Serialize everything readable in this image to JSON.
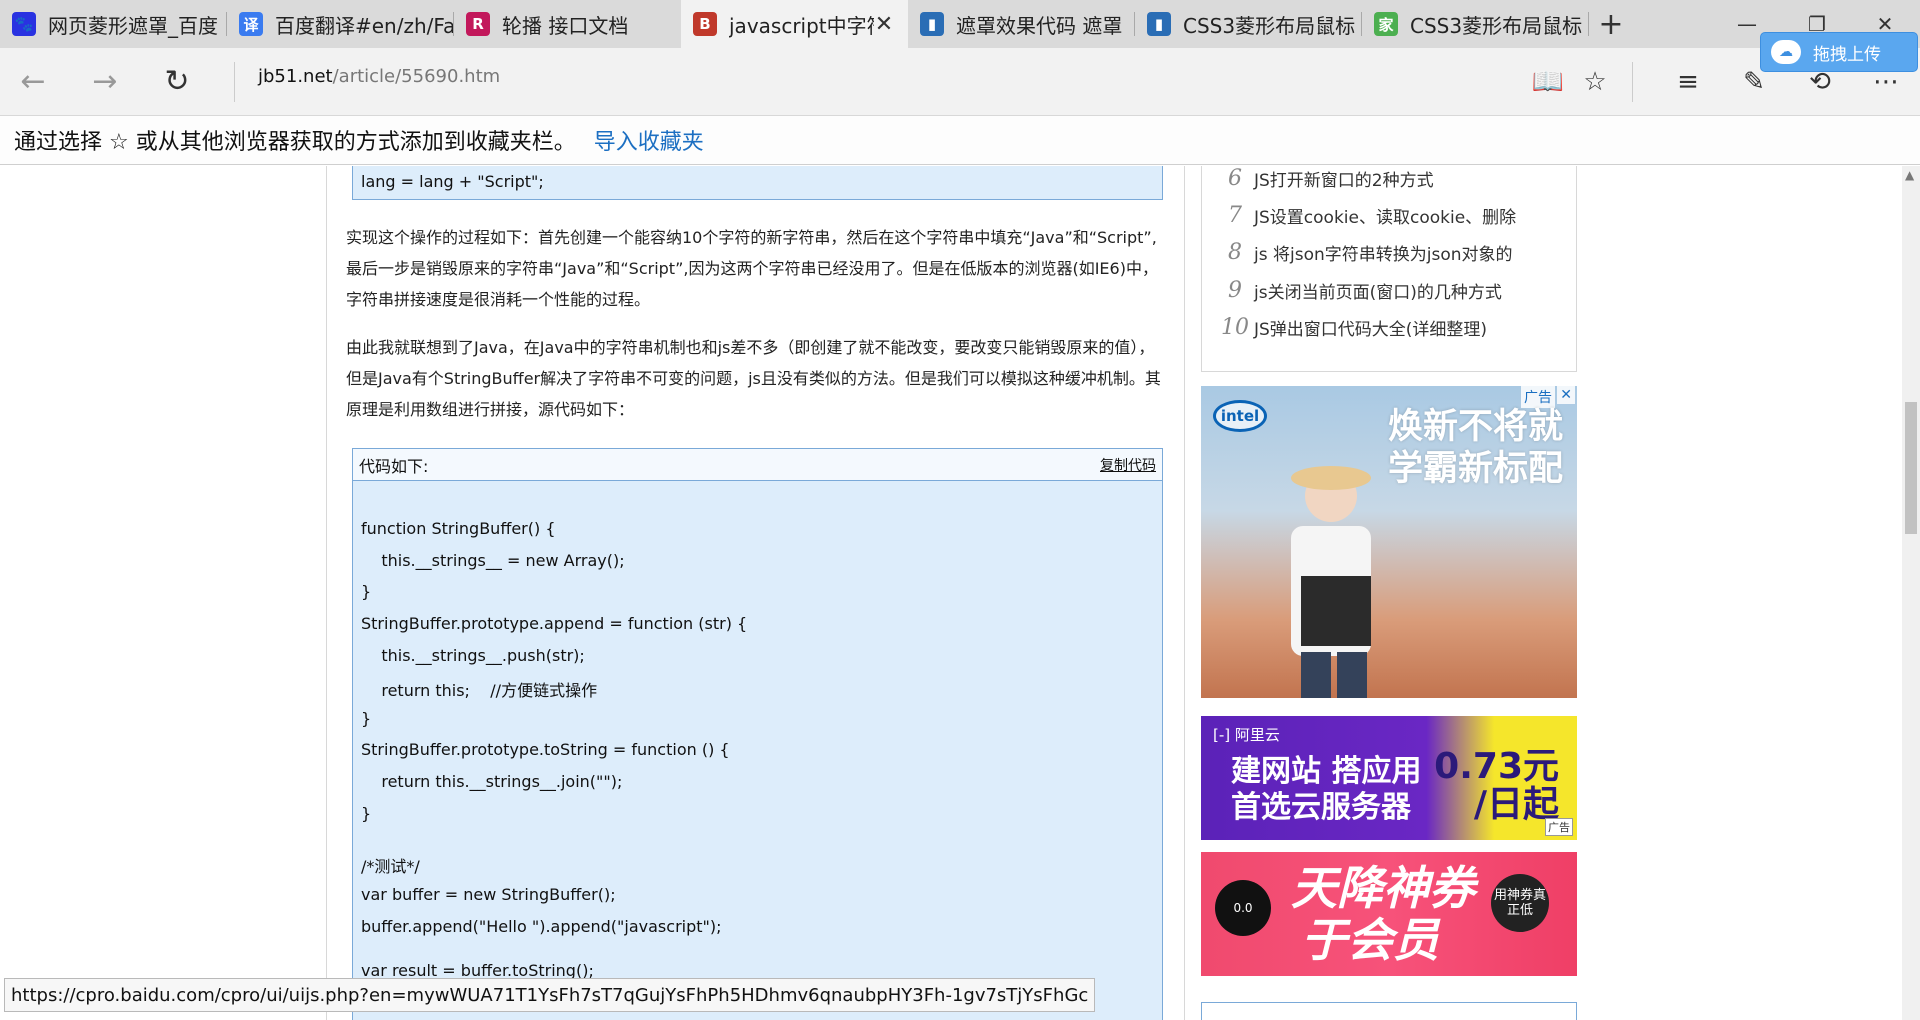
{
  "tabs": [
    {
      "label": "网页菱形遮罩_百度",
      "icon": "baidu-paw-icon",
      "icon_glyph": "🐾",
      "icon_color": "#2932e1"
    },
    {
      "label": "百度翻译#en/zh/Fa",
      "icon": "translate-icon",
      "icon_glyph": "译",
      "icon_color": "#3a7bf0"
    },
    {
      "label": "轮播 接口文档",
      "icon": "r-logo-icon",
      "icon_glyph": "R",
      "icon_color": "#c2185b"
    },
    {
      "label": "javascript中字符",
      "icon": "jb51-logo-icon",
      "icon_glyph": "B",
      "icon_color": "#c0392b"
    },
    {
      "label": "遮罩效果代码 遮罩",
      "icon": "site-logo-icon",
      "icon_glyph": "▮",
      "icon_color": "#2a6db5"
    },
    {
      "label": "CSS3菱形布局鼠标",
      "icon": "site-logo-icon",
      "icon_glyph": "▮",
      "icon_color": "#2a6db5"
    },
    {
      "label": "CSS3菱形布局鼠标",
      "icon": "home-logo-icon",
      "icon_glyph": "家",
      "icon_color": "#4caf50"
    }
  ],
  "address": {
    "host": "jb51.net",
    "path": "/article/55690.htm"
  },
  "upload_label": "拖拽上传",
  "favbar": {
    "text": "通过选择 ☆ 或从其他浏览器获取的方式添加到收藏夹栏。",
    "link": "导入收藏夹"
  },
  "article": {
    "top_code_line": "lang = lang + \"Script\";",
    "para1": " 实现这个操作的过程如下：首先创建一个能容纳10个字符的新字符串，然后在这个字符串中填充“Java”和“Script”,最后一步是销毁原来的字符串“Java”和“Script”,因为这两个字符串已经没用了。但是在低版本的浏览器(如IE6)中，字符串拼接速度是很消耗一个性能的过程。",
    "para2": "由此我就联想到了Java，在Java中的字符串机制也和js差不多（即创建了就不能改变，要改变只能销毁原来的值），但是Java有个StringBuffer解决了字符串不可变的问题，js且没有类似的方法。但是我们可以模拟这种缓冲机制。其原理是利用数组进行拼接，源代码如下：",
    "code_header": "代码如下:",
    "copy_label": "复制代码",
    "code_lines": [
      "function StringBuffer() {",
      "    this.__strings__ = new Array();",
      "}",
      "StringBuffer.prototype.append = function (str) {",
      "    this.__strings__.push(str);",
      "    return this;    //方便链式操作",
      "}",
      "StringBuffer.prototype.toString = function () {",
      "    return this.__strings__.join(\"\");",
      "}",
      "/*测试*/",
      "var buffer = new StringBuffer();",
      "buffer.append(\"Hello \").append(\"javascript\");",
      "var result = buffer.toString();"
    ]
  },
  "sidebar_list": [
    {
      "num": "6",
      "text": "JS打开新窗口的2种方式"
    },
    {
      "num": "7",
      "text": "JS设置cookie、读取cookie、删除"
    },
    {
      "num": "8",
      "text": "js 将json字符串转换为json对象的"
    },
    {
      "num": "9",
      "text": "js关闭当前页面(窗口)的几种方式"
    },
    {
      "num": "10",
      "text": "JS弹出窗口代码大全(详细整理)"
    }
  ],
  "ads": {
    "intel": {
      "tag": "广告",
      "close": "✕",
      "logo": "intel",
      "slogan_line1": "焕新不将就",
      "slogan_line2": "学霸新标配"
    },
    "aliyun": {
      "brand": "[-] 阿里云",
      "line1": "建网站 搭应用",
      "line2": "首选云服务器",
      "price_line1": "0.73元",
      "price_line2": "/日起",
      "mini": "广告"
    },
    "taobao": {
      "title_line1": "天降神券",
      "title_line2": "于会员",
      "badge": "用神券真正低",
      "cat": "0.0"
    }
  },
  "status_url": "https://cpro.baidu.com/cpro/ui/uijs.php?en=mywWUA71T1YsFh7sT7qGujYsFhPh5HDhmv6qnaubpHY3Fh-1gv7sTjYsFhGc"
}
